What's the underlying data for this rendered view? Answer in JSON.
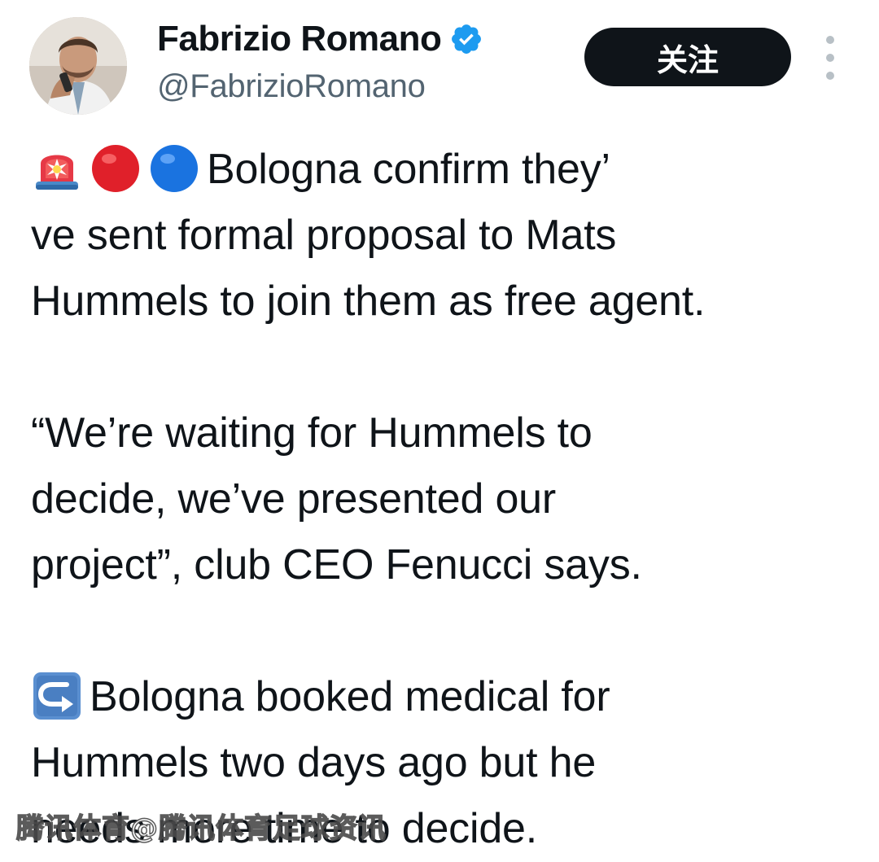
{
  "author": {
    "display_name": "Fabrizio Romano",
    "handle": "@FabrizioRomano",
    "verified_icon": "verified-badge-icon",
    "avatar_icon": "profile-photo"
  },
  "header": {
    "follow_label": "关注",
    "more_icon": "more-vertical-icon"
  },
  "tweet": {
    "paragraph1": {
      "emojis": [
        "rotating-light-icon",
        "red-circle-icon",
        "blue-circle-icon"
      ],
      "line1": "Bologna confirm they’",
      "line2": "ve sent formal proposal to Mats",
      "line3": "Hummels to join them as free agent."
    },
    "paragraph2": {
      "line1": "“We’re waiting for Hummels to",
      "line2": "decide, we’ve presented our",
      "line3": "project”, club CEO Fenucci says."
    },
    "paragraph3": {
      "emoji": "right-arrow-curving-left-icon",
      "line1": "Bologna booked medical for",
      "line2": "Hummels two days ago but he",
      "line3": "needs more time to decide."
    }
  },
  "watermark": {
    "text": "腾讯体育@腾讯体育足球资讯"
  },
  "colors": {
    "text": "#0f1419",
    "secondary_text": "#536471",
    "verified_blue": "#1d9bf0",
    "follow_button_bg": "#0f1419",
    "follow_button_text": "#ffffff"
  }
}
